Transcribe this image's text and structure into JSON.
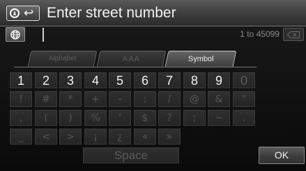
{
  "title": "Enter street number",
  "input": {
    "value": "",
    "range_hint": "1 to 45099"
  },
  "tabs": [
    {
      "label": "Alphabet",
      "selected": false
    },
    {
      "label": "AAA",
      "selected": false
    },
    {
      "label": "Symbol",
      "selected": true
    }
  ],
  "keyboard": {
    "row1": [
      "1",
      "2",
      "3",
      "4",
      "5",
      "6",
      "7",
      "8",
      "9",
      "0"
    ],
    "row2": [
      "!",
      "#",
      "*",
      "+",
      "-",
      ":",
      "/",
      "@",
      "&",
      "\""
    ],
    "row3": [
      ",",
      "(",
      ")",
      "%",
      "'",
      "$",
      "?",
      ";",
      "~",
      "."
    ],
    "row4": [
      "_",
      "<",
      ">",
      "¡",
      "¿",
      "«",
      "»"
    ],
    "space_label": "Space",
    "ok_label": "OK"
  },
  "icons": {
    "nav": "north-up-back-icon",
    "globe": "globe-icon",
    "delete": "delete-icon"
  },
  "colors": {
    "active_key_text": "#f4f4f4",
    "inactive_key_text": "#555555"
  }
}
